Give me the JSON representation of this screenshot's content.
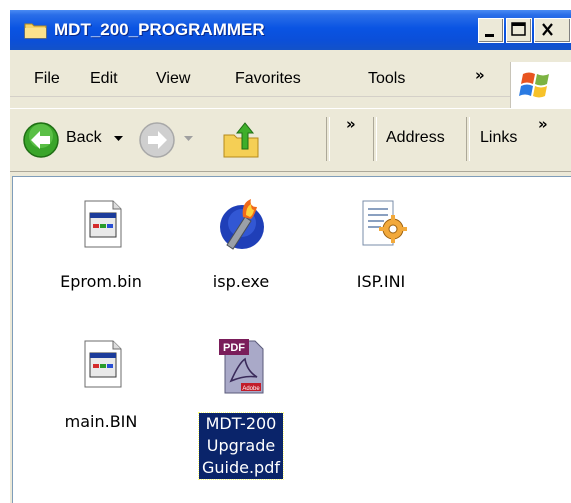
{
  "window": {
    "title": "MDT_200_PROGRAMMER"
  },
  "menubar": {
    "items": [
      "File",
      "Edit",
      "View",
      "Favorites",
      "Tools"
    ],
    "more": "»"
  },
  "toolbar": {
    "back_label": "Back",
    "more": "»",
    "address_label": "Address",
    "links_label": "Links",
    "links_more": "»"
  },
  "files": [
    {
      "name": "Eprom.bin",
      "icon": "binary-file-icon"
    },
    {
      "name": "isp.exe",
      "icon": "torch-exe-icon"
    },
    {
      "name": "ISP.INI",
      "icon": "ini-settings-icon"
    },
    {
      "name": "main.BIN",
      "icon": "binary-file-icon"
    },
    {
      "name_lines": [
        "MDT-200",
        "Upgrade",
        "Guide.pdf"
      ],
      "icon": "pdf-file-icon",
      "selected": true
    }
  ],
  "colors": {
    "titlebar": "#0a54e3",
    "selection": "#0a246a",
    "chrome": "#ece9d8"
  }
}
